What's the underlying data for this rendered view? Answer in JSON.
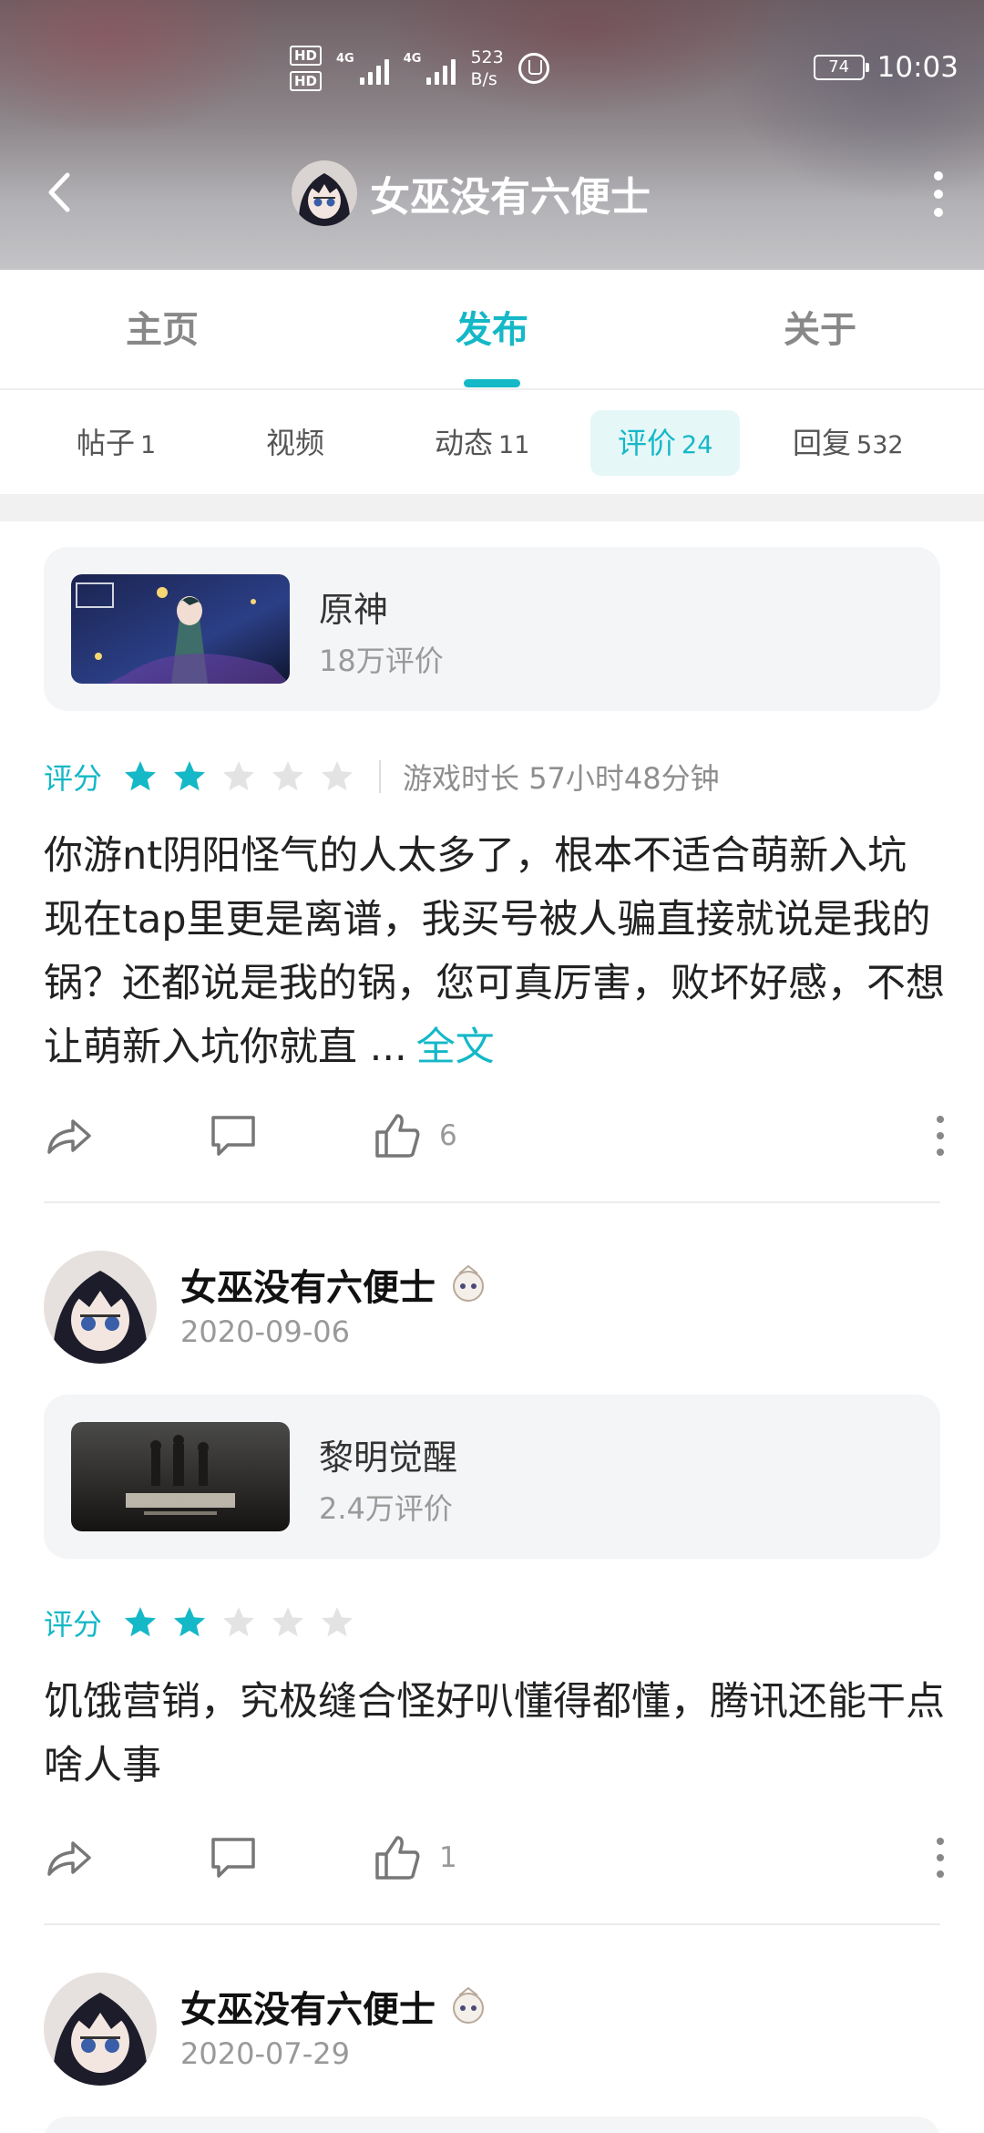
{
  "status_bar": {
    "hd1": "HD",
    "hd2": "HD",
    "signal1_label": "4G",
    "signal2_label": "4G",
    "speed_value": "523",
    "speed_unit": "B/s",
    "battery": "74",
    "time": "10:03"
  },
  "header": {
    "title": "女巫没有六便士",
    "back_icon": "back-arrow-icon",
    "more_icon": "more-vertical-icon"
  },
  "main_tabs": [
    {
      "label": "主页",
      "active": false
    },
    {
      "label": "发布",
      "active": true
    },
    {
      "label": "关于",
      "active": false
    }
  ],
  "sub_tabs": [
    {
      "label": "帖子",
      "count": "1"
    },
    {
      "label": "视频",
      "count": ""
    },
    {
      "label": "动态",
      "count": "11"
    },
    {
      "label": "评价",
      "count": "24",
      "active": true
    },
    {
      "label": "回复",
      "count": "532"
    }
  ],
  "reviews": [
    {
      "game": {
        "name": "原神",
        "rating_count": "18万评价"
      },
      "rating_label": "评分",
      "stars": 2,
      "max_stars": 5,
      "playtime": "游戏时长 57小时48分钟",
      "text": "你游nt阴阳怪气的人太多了，根本不适合萌新入坑现在tap里更是离谱，我买号被人骗直接就说是我的锅？还都说是我的锅，您可真厉害，败坏好感，不想让萌新入坑你就直 ...",
      "full_text_link": "全文",
      "likes": "6"
    },
    {
      "author": {
        "name": "女巫没有六便士",
        "date": "2020-09-06"
      },
      "game": {
        "name": "黎明觉醒",
        "rating_count": "2.4万评价"
      },
      "rating_label": "评分",
      "stars": 2,
      "max_stars": 5,
      "text": "饥饿营销，究极缝合怪好叭懂得都懂，腾讯还能干点啥人事",
      "likes": "1"
    },
    {
      "author": {
        "name": "女巫没有六便士",
        "date": "2020-07-29"
      }
    }
  ],
  "colors": {
    "accent": "#14b8c7",
    "star_empty": "#e3e3e3",
    "card_bg": "#f4f5f7"
  }
}
